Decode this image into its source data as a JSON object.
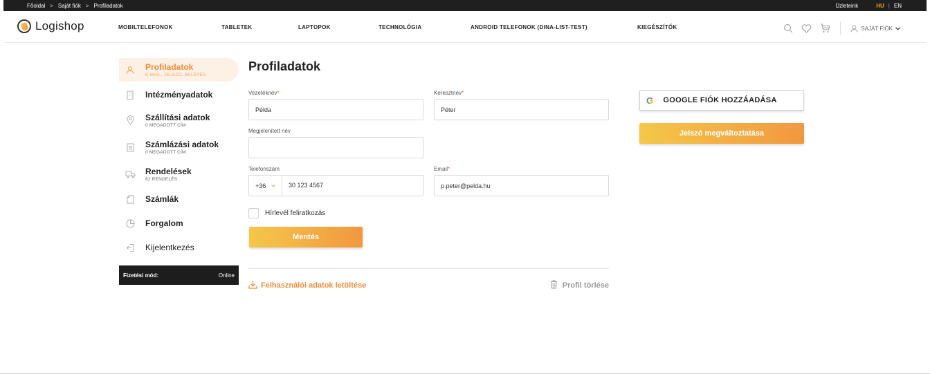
{
  "breadcrumb": {
    "items": [
      "Főoldal",
      "Saját fiók",
      "Profiladatok"
    ],
    "separator": ">"
  },
  "topbar": {
    "stores_label": "Üzleteink",
    "lang_hu": "HU",
    "lang_sep": "|",
    "lang_en": "EN"
  },
  "header": {
    "logo_text": "Logishop",
    "nav": [
      "MOBILTELEFONOK",
      "TABLETEK",
      "LAPTOPOK",
      "TECHNOLÓGIA",
      "ANDROID TELEFONOK (DINA-LIST-TEST)",
      "KIEGÉSZÍTŐK"
    ],
    "account_label": "SAJÁT FIÓK",
    "icons": [
      "search-icon",
      "heart-icon",
      "cart-icon",
      "user-icon",
      "chevron-down-icon"
    ]
  },
  "sidebar": {
    "items": [
      {
        "title": "Profiladatok",
        "sub": "E-MAIL, JELSZÓ, BELÉPÉS",
        "icon": "user-icon",
        "active": true
      },
      {
        "title": "Intézményadatok",
        "sub": "",
        "icon": "building-icon"
      },
      {
        "title": "Szállítási adatok",
        "sub": "0 MEGADOTT CÍM",
        "icon": "location-pin-icon"
      },
      {
        "title": "Számlázási adatok",
        "sub": "0 MEGADOTT CÍM",
        "icon": "document-icon"
      },
      {
        "title": "Rendelések",
        "sub": "62 RENDELÉS",
        "icon": "truck-icon"
      },
      {
        "title": "Számlák",
        "sub": "",
        "icon": "invoice-icon"
      },
      {
        "title": "Forgalom",
        "sub": "",
        "icon": "pie-chart-icon"
      },
      {
        "title": "Kijelentkezés",
        "sub": "",
        "icon": "logout-icon"
      }
    ],
    "payment_label": "Fizetési mód:",
    "payment_value": "Online"
  },
  "form": {
    "title": "Profiladatok",
    "lastname_label": "Vezetéknév",
    "lastname_value": "Példa",
    "firstname_label": "Keresztnév",
    "firstname_value": "Péter",
    "display_label": "Megjelenített név",
    "display_value": "",
    "phone_label": "Telefonszám",
    "phone_prefix": "+36",
    "phone_value": "30 123 4567",
    "email_label": "Email",
    "email_value": "p.peter@pelda.hu",
    "required_mark": "*",
    "newsletter_label": "Hírlevél feliratkozás",
    "save_label": "Mentés",
    "download_label": "Felhasználói adatok letöltése",
    "delete_label": "Profil törlése"
  },
  "right": {
    "google_label": "GOOGLE FIÓK HOZZÁADÁSA",
    "google_letter": "G",
    "password_label": "Jelszó megváltoztatása"
  },
  "colors": {
    "accent": "#ef8d3a",
    "gradient_start": "#f5c74a",
    "gradient_end": "#f1983f",
    "topbar": "#1f1f1f"
  }
}
